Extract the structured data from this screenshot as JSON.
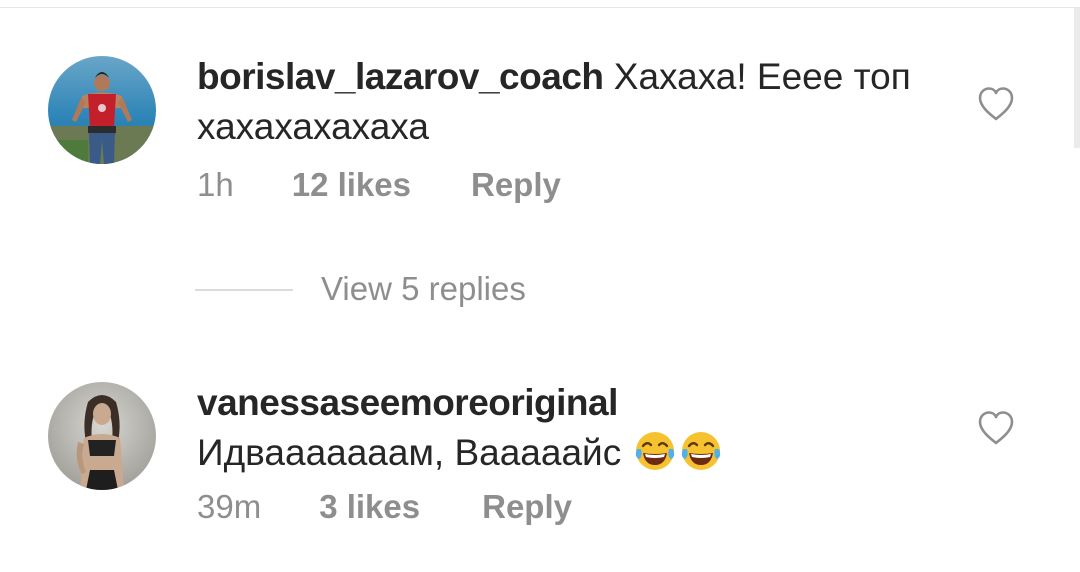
{
  "comments": [
    {
      "username": "borislav_lazarov_coach",
      "text": "Хахаха! Ееее топ хахахахахаха",
      "emoji_icons": [],
      "time": "1h",
      "likes": "12 likes",
      "reply": "Reply",
      "liked": false
    },
    {
      "username": "vanessaseemoreoriginal",
      "text": "Идвааааааам, Вааааайс",
      "emoji_icons": [
        "face-with-tears-of-joy-icon",
        "face-with-tears-of-joy-icon"
      ],
      "time": "39m",
      "likes": "3 likes",
      "reply": "Reply",
      "liked": false
    }
  ],
  "view_replies": "View 5 replies",
  "colors": {
    "primary_text": "#262626",
    "secondary_text": "#8e8e8e",
    "divider": "#dbdbdb"
  }
}
